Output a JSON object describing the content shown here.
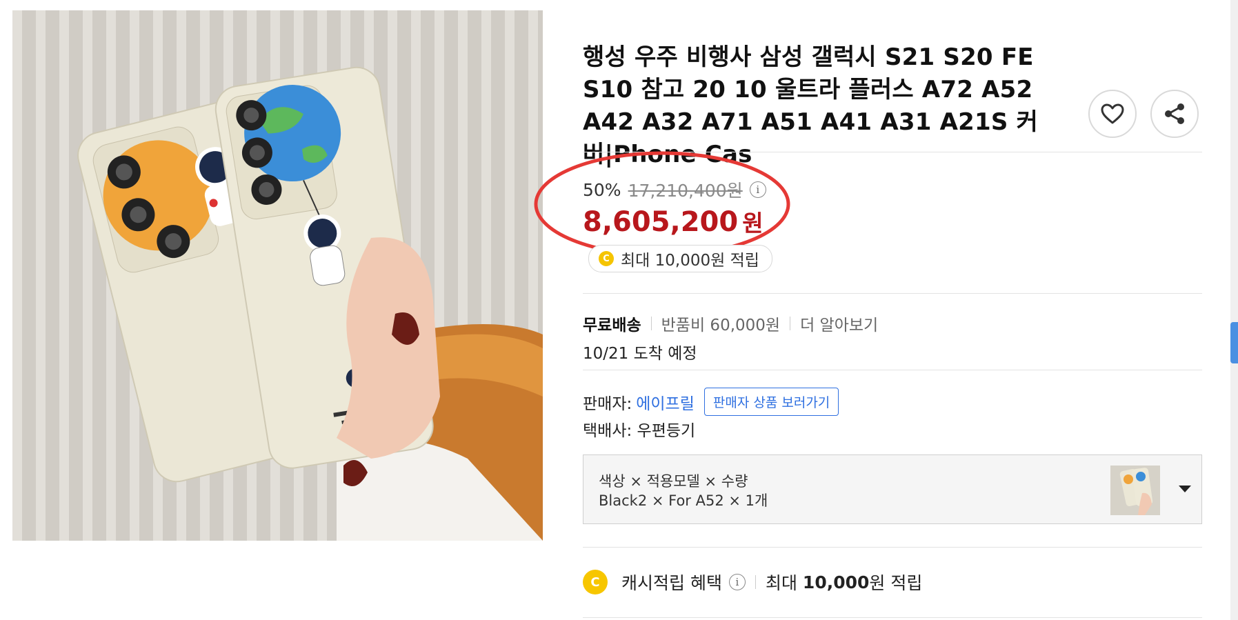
{
  "product": {
    "title": "행성 우주 비행사 삼성 갤럭시 S21 S20 FE S10 참고 20 10 울트라 플러스 A72 A52 A42 A32 A71 A51 A41 A31 A21S 커버|Phone Cas"
  },
  "actions": {
    "wishlist_icon": "heart-icon",
    "share_icon": "share-icon"
  },
  "price": {
    "discount_rate": "50%",
    "original_price": "17,210,400원",
    "info_mark": "i",
    "sale_price": "8,605,200",
    "currency": "원",
    "color": "#b8171c"
  },
  "cash_reward": {
    "coin_letter": "C",
    "text": "최대 10,000원 적립"
  },
  "shipping": {
    "free_label": "무료배송",
    "return_fee": "반품비 60,000원",
    "more_link": "더 알아보기",
    "arrival": "10/21 도착 예정"
  },
  "seller": {
    "label": "판매자:",
    "name": "에이프릴",
    "link_label": "판매자 상품 보러가기",
    "courier": "택배사: 우편등기"
  },
  "option": {
    "label": "색상 × 적용모델 × 수량",
    "value": "Black2 × For A52 × 1개"
  },
  "benefit": {
    "coin_letter": "C",
    "title": "캐시적립 혜택",
    "info_mark": "i",
    "prefix": "최대",
    "amount": "10,000",
    "suffix": "원 적립"
  },
  "colors": {
    "accent_blue": "#2e6fe0",
    "highlight_circle": "#e53935"
  }
}
